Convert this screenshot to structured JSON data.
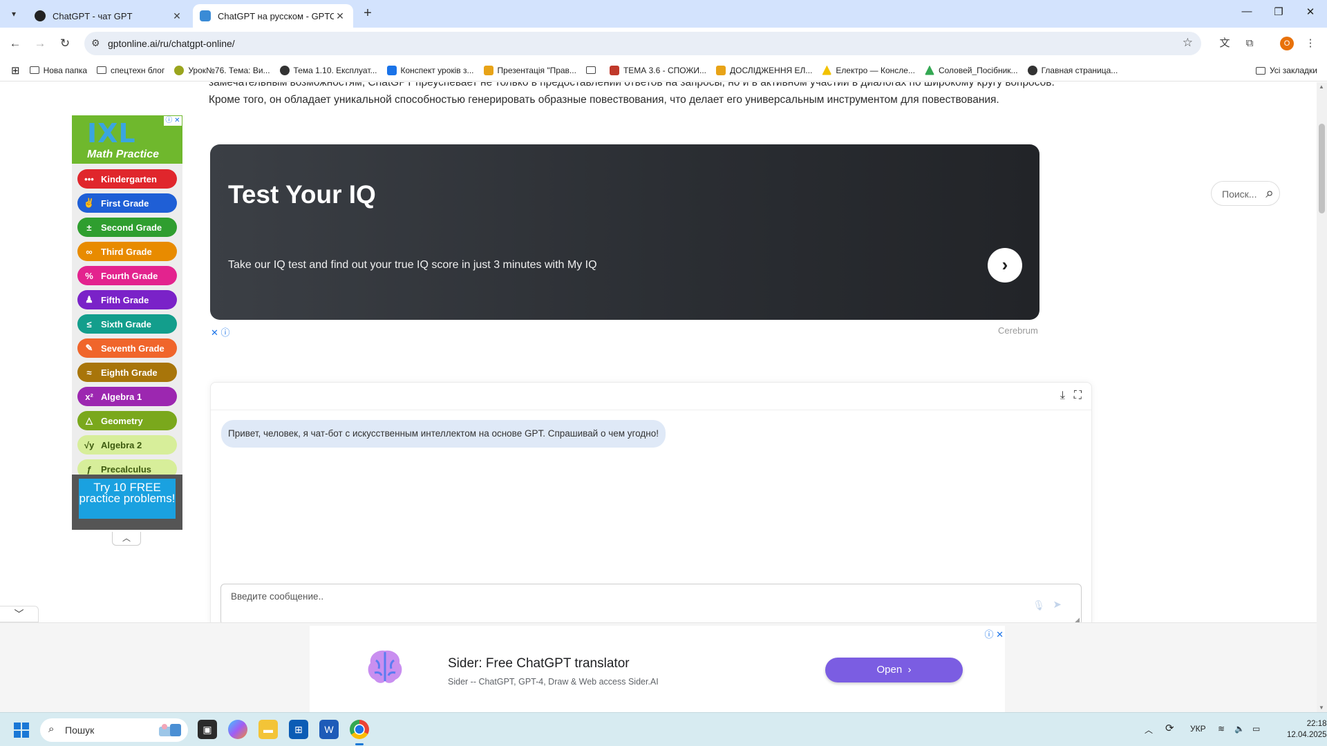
{
  "browser": {
    "tabs": [
      {
        "title": "ChatGPT - чат GPT",
        "active": false
      },
      {
        "title": "ChatGPT на русском - GPTOnline",
        "active": true
      }
    ],
    "url": "gptonline.ai/ru/chatgpt-online/",
    "profile_initial": "O",
    "bookmarks": [
      {
        "label": "Нова папка",
        "icon": "folder-icon",
        "color": "#444444"
      },
      {
        "label": "спецтехн блог",
        "icon": "folder-icon",
        "color": "#444444"
      },
      {
        "label": "Урок№76. Тема: Ви...",
        "icon": "site-icon",
        "color": "#9aa51e"
      },
      {
        "label": "Тема 1.10. Експлуат...",
        "icon": "site-icon",
        "color": "#333333"
      },
      {
        "label": "Конспект уроків з...",
        "icon": "site-icon",
        "color": "#1a73e8"
      },
      {
        "label": "Презентація \"Прав...",
        "icon": "site-icon",
        "color": "#e8a317"
      },
      {
        "label": "",
        "icon": "folder-icon",
        "color": "#444444"
      },
      {
        "label": "ТЕМА 3.6 - СПОЖИ...",
        "icon": "site-icon",
        "color": "#c0392b"
      },
      {
        "label": "ДОСЛІДЖЕННЯ ЕЛ...",
        "icon": "site-icon",
        "color": "#e8a317"
      },
      {
        "label": "Електро — Консле...",
        "icon": "warning-icon",
        "color": "#f2c200"
      },
      {
        "label": "Соловей_Посібник...",
        "icon": "drive-icon",
        "color": "#34a853"
      },
      {
        "label": "Главная страница...",
        "icon": "site-icon",
        "color": "#333333"
      }
    ],
    "all_bookmarks": "Усі закладки"
  },
  "page": {
    "intro_lines": [
      "замечательным возможностям, ChatGPT преуспевает не только в предоставлении ответов на запросы, но и в активном участии в диалогах по широкому кругу вопросов.",
      "Кроме того, он обладает уникальной способностью генерировать образные повествования, что делает его универсальным инструментом для повествования."
    ],
    "iq_ad": {
      "title": "Test Your IQ",
      "subtitle": "Take our IQ test and find out your true IQ score in just 3 minutes with My IQ",
      "arrow": "›",
      "sponsor": "Cerebrum",
      "adchoices": "✕ ⓘ"
    },
    "ixl_ad": {
      "logo": "IXL",
      "tagline": "Math Practice",
      "grades": [
        {
          "label": "Kindergarten",
          "icon": "•••",
          "color": "#e0262c"
        },
        {
          "label": "First Grade",
          "icon": "✌",
          "color": "#1f5fd6"
        },
        {
          "label": "Second Grade",
          "icon": "±",
          "color": "#2f9e2f"
        },
        {
          "label": "Third Grade",
          "icon": "∞",
          "color": "#e88b00"
        },
        {
          "label": "Fourth Grade",
          "icon": "%",
          "color": "#e3238e"
        },
        {
          "label": "Fifth Grade",
          "icon": "♟",
          "color": "#7a22c8"
        },
        {
          "label": "Sixth Grade",
          "icon": "≤",
          "color": "#139e8c"
        },
        {
          "label": "Seventh Grade",
          "icon": "✎",
          "color": "#f0652b"
        },
        {
          "label": "Eighth Grade",
          "icon": "≈",
          "color": "#a8750a"
        },
        {
          "label": "Algebra 1",
          "icon": "x²",
          "color": "#9c27b0"
        },
        {
          "label": "Geometry",
          "icon": "△",
          "color": "#7aa81c"
        },
        {
          "label": "Algebra 2",
          "icon": "√y",
          "color": "#d7ee9a"
        },
        {
          "label": "Precalculus",
          "icon": "ƒ",
          "color": "#d7ee9a"
        }
      ],
      "cta": "Try 10 FREE practice problems!"
    },
    "search_placeholder": "Поиск...",
    "chat": {
      "greeting": "Привет, человек, я чат-бот с искусственным интеллектом на основе GPT. Спрашивай о чем угодно!",
      "input_placeholder": "Введите сообщение.."
    },
    "sider_ad": {
      "title": "Sider: Free ChatGPT translator",
      "subtitle": "Sider -- ChatGPT, GPT-4, Draw & Web access Sider.AI",
      "button": "Open"
    }
  },
  "taskbar": {
    "search_label": "Пошук",
    "language": "УКР",
    "time": "22:18",
    "date": "12.04.2025"
  }
}
